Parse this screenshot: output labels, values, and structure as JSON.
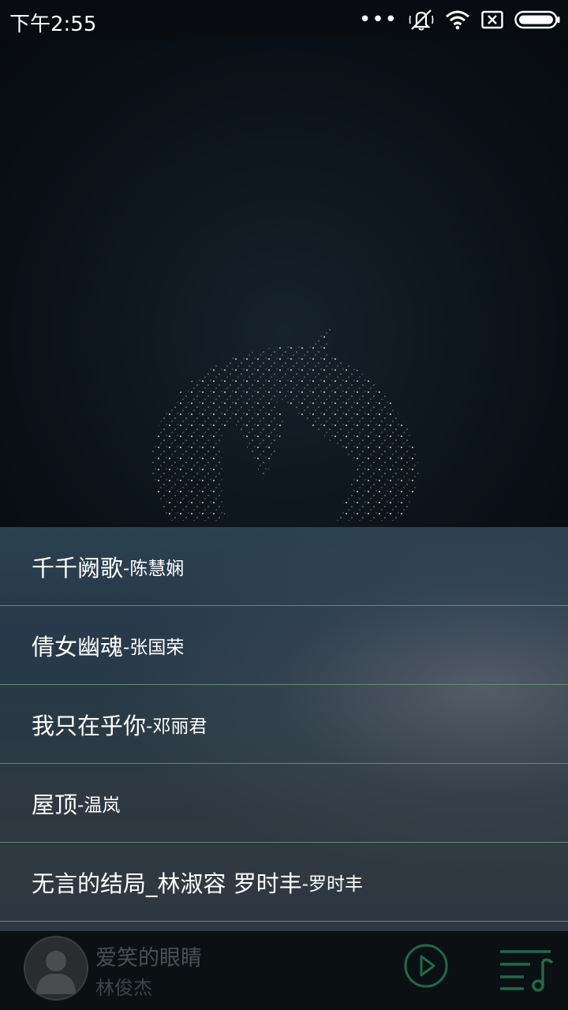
{
  "status_bar": {
    "time": "下午2:55",
    "icons": [
      "more-dots-icon",
      "mute-icon",
      "wifi-icon",
      "sim-none-icon",
      "battery-icon"
    ]
  },
  "songs": [
    {
      "title": "千千阙歌",
      "artist": "-陈慧娴"
    },
    {
      "title": "倩女幽魂",
      "artist": "-张国荣"
    },
    {
      "title": "我只在乎你",
      "artist": "-邓丽君"
    },
    {
      "title": "屋顶",
      "artist": "-温岚"
    },
    {
      "title": "无言的结局_林淑容 罗时丰",
      "artist": "-罗时丰"
    }
  ],
  "player": {
    "title": "爱笑的眼睛",
    "artist": "林俊杰",
    "accent_color": "#1e6b48"
  }
}
